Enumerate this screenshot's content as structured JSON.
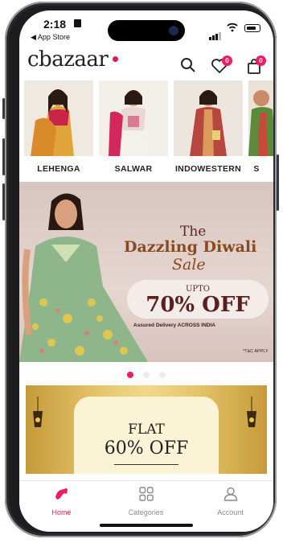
{
  "status_bar": {
    "time": "2:18",
    "back_label": "◀ App Store"
  },
  "header": {
    "logo_text": "cbazaar",
    "wishlist_count": "0",
    "cart_count": "0"
  },
  "categories": [
    {
      "label": "LEHENGA"
    },
    {
      "label": "SALWAR"
    },
    {
      "label": "INDOWESTERN"
    },
    {
      "label": "S"
    }
  ],
  "banner": {
    "line_the": "The",
    "title": "Dazzling Diwali",
    "sale": "Sale",
    "upto": "UPTO",
    "discount": "70% OFF",
    "delivery": "Assured Delivery ACROSS INDIA",
    "tc": "*T&C APPLY",
    "dots_total": 3,
    "active_dot": 1
  },
  "promo": {
    "flat": "FLAT",
    "discount": "60% OFF"
  },
  "tabs": [
    {
      "label": "Home",
      "active": true
    },
    {
      "label": "Categories",
      "active": false
    },
    {
      "label": "Account",
      "active": false
    }
  ],
  "colors": {
    "accent": "#e91e63",
    "text": "#222222",
    "tab_inactive": "#8a8a8a"
  }
}
